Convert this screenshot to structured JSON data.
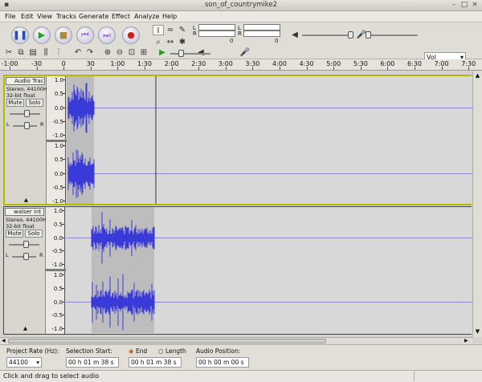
{
  "window": {
    "title": "son_of_countrymike2"
  },
  "menubar": [
    "File",
    "Edit",
    "View",
    "Tracks",
    "Generate",
    "Effect",
    "Analyze",
    "Help"
  ],
  "transport": {
    "pause": "pause-icon",
    "play": "play-icon",
    "stop": "stop-icon",
    "skip_start": "skip-to-start-icon",
    "skip_end": "skip-to-end-icon",
    "record": "record-icon",
    "colors": {
      "pause": "#2650b0",
      "play": "#28a028",
      "stop": "#b08a3a",
      "skip": "#9b6ad4",
      "record": "#cc2020"
    }
  },
  "meters": {
    "playback_l": "L",
    "playback_r": "R",
    "record_l": "L",
    "record_r": "R",
    "scale_zero": "0",
    "scale_zero2": "0"
  },
  "mixer": {
    "input_select": "Vol"
  },
  "ruler": {
    "labels": [
      "-1:00",
      "-30",
      "0",
      "30",
      "1:00",
      "1:30",
      "2:00",
      "2:30",
      "3:00",
      "3:30",
      "4:00",
      "4:30",
      "5:00",
      "5:30",
      "6:00",
      "6:30",
      "7:00",
      "7:30"
    ]
  },
  "tracks": [
    {
      "name": "Audio Trac",
      "info1": "Stereo, 44100Hz",
      "info2": "32-bit float",
      "mute": "Mute",
      "solo": "Solo",
      "pan_l": "L",
      "pan_r": "R",
      "scale": [
        "1.0",
        "0.5",
        "0.0",
        "-0.5",
        "-1.0"
      ],
      "wave_color": "#3a3ad8",
      "selected": true
    },
    {
      "name": "walser int",
      "info1": "Stereo, 44100Hz",
      "info2": "32-bit float",
      "mute": "Mute",
      "solo": "Solo",
      "pan_l": "L",
      "pan_r": "R",
      "scale": [
        "1.0",
        "0.5",
        "0.0",
        "-0.5",
        "-1.0"
      ],
      "wave_color": "#3a3ad8",
      "selected": false
    }
  ],
  "bottom": {
    "rate_label": "Project Rate (Hz):",
    "rate_value": "44100",
    "sel_start_label": "Selection Start:",
    "end_label": "End",
    "length_label": "Length",
    "audio_pos_label": "Audio Position:",
    "sel_start_value": "00 h 01 m 38 s",
    "end_value": "00 h 01 m 38 s",
    "audio_pos_value": "00 h 00 m 00 s"
  },
  "status": {
    "text": "Click and drag to select audio"
  }
}
